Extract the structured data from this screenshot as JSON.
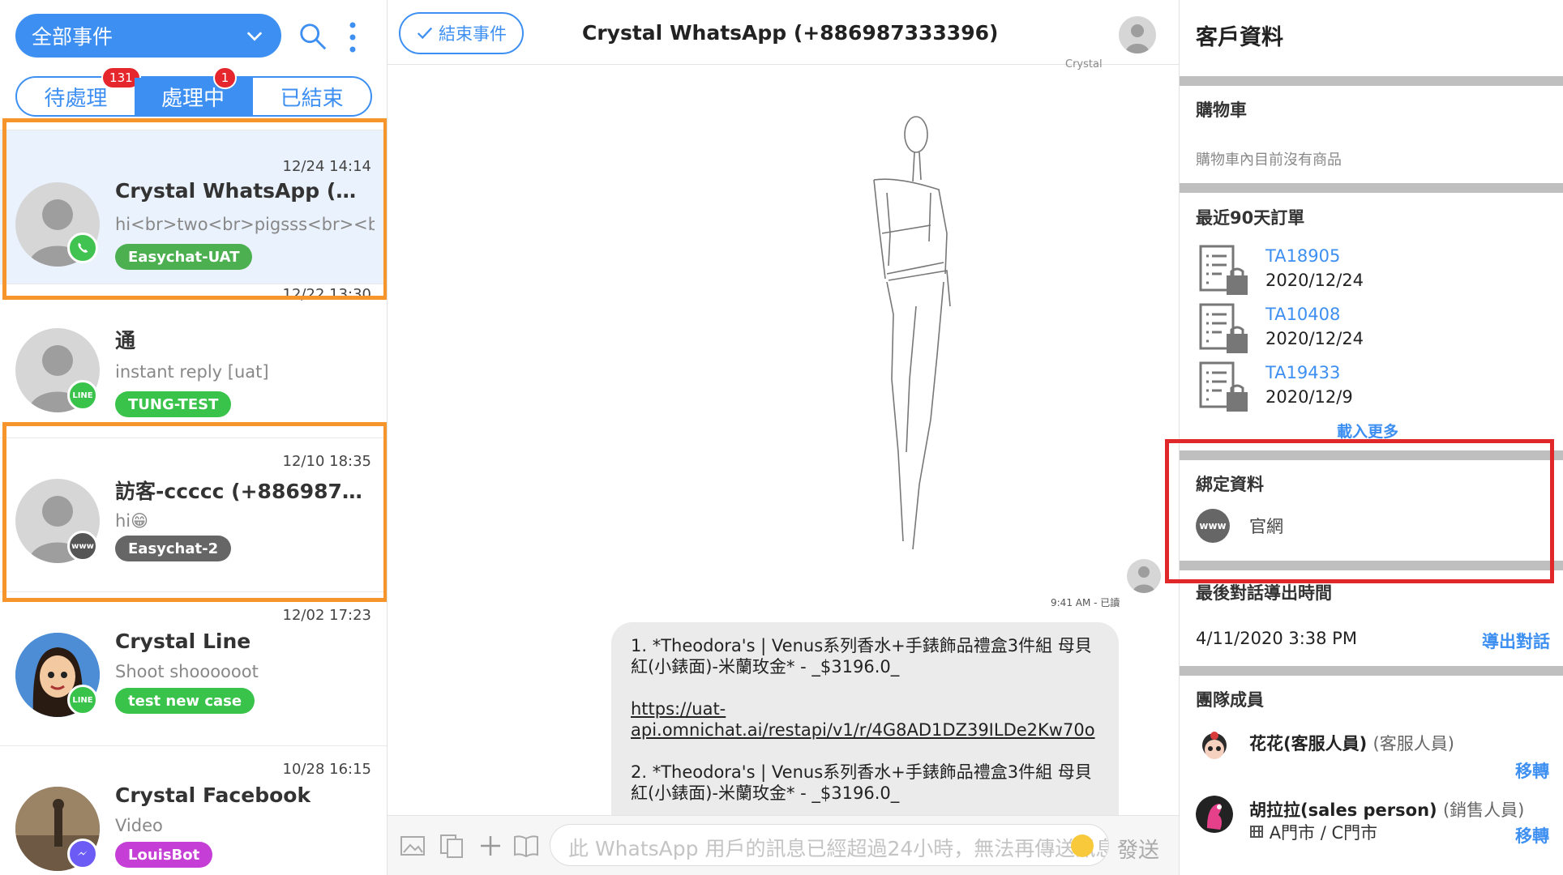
{
  "left": {
    "filter_label": "全部事件",
    "tabs": [
      {
        "label": "待處理",
        "badge": "131"
      },
      {
        "label": "處理中",
        "badge": "1"
      },
      {
        "label": "已結束",
        "badge": ""
      }
    ],
    "conversations": [
      {
        "time": "12/24 14:14",
        "name": "Crystal WhatsApp (+88…",
        "message": "hi<br>two<br>pigsss<br><br>l",
        "tag": "Easychat-UAT",
        "tag_color": "#4caf50",
        "channel": "whatsapp-icon",
        "channel_color": "#40c351"
      },
      {
        "time": "12/22 13:30",
        "name": "通",
        "message": "instant reply [uat]",
        "tag": "TUNG-TEST",
        "tag_color": "#3ac34b",
        "channel": "line-icon",
        "channel_color": "#3ac34b"
      },
      {
        "time": "12/10 18:35",
        "name": "訪客-ccccc (+88698777…",
        "message": "hi😁",
        "tag": "Easychat-2",
        "tag_color": "#666666",
        "channel": "www-icon",
        "channel_color": "#555555"
      },
      {
        "time": "12/02 17:23",
        "name": "Crystal Line",
        "message": "Shoot shoooooot",
        "tag": "test new case",
        "tag_color": "#3ac34b",
        "channel": "line-icon",
        "channel_color": "#3ac34b"
      },
      {
        "time": "10/28 16:15",
        "name": "Crystal Facebook",
        "message": "Video",
        "tag": "LouisBot",
        "tag_color": "#c53fd6",
        "channel": "messenger-icon",
        "channel_color": "#6c5cf5"
      }
    ]
  },
  "chat": {
    "end_button": "結束事件",
    "title": "Crystal WhatsApp (+886987333396)",
    "sender_partial": "Crystal",
    "meta": "9:41 AM - 已讀",
    "bubble": {
      "item1": "1. *Theodora's | Venus系列香水+手錶飾品禮盒3件組 母貝紅(小錶面)-米蘭玫金* - _$3196.0_",
      "link": "https://uat-api.omnichat.ai/restapi/v1/r/4G8AD1DZ39ILDe2Kw70o",
      "item2": "2. *Theodora's | Venus系列香水+手錶飾品禮盒3件組 母貝紅(小錶面)-米蘭玫金* - _$3196.0_"
    },
    "composer_placeholder": "此 WhatsApp 用戶的訊息已經超過24小時，無法再傳送訊息",
    "send_label": "發送"
  },
  "customer": {
    "title": "客戶資料",
    "cart_title": "購物車",
    "cart_empty": "購物車內目前沒有商品",
    "orders_title": "最近90天訂單",
    "orders": [
      {
        "id": "TA18905",
        "date": "2020/12/24"
      },
      {
        "id": "TA10408",
        "date": "2020/12/24"
      },
      {
        "id": "TA19433",
        "date": "2020/12/9"
      }
    ],
    "load_more": "載入更多",
    "binding_title": "綁定資料",
    "binding_icon": "www",
    "binding_label": "官網",
    "export_title": "最後對話導出時間",
    "export_time": "4/11/2020 3:38 PM",
    "export_button": "導出對話",
    "team_title": "團隊成員",
    "members": [
      {
        "name": "花花(客服人員)",
        "role": "(客服人員)",
        "store": "",
        "move": "移轉"
      },
      {
        "name": "胡拉拉(sales person)",
        "role": "(銷售人員)",
        "store": "A門市 / C門市",
        "move": "移轉"
      }
    ]
  },
  "colors": {
    "accent": "#3d8ff2",
    "badge": "#e5262d",
    "highlight_orange": "#f5952c",
    "highlight_red": "#e0282a"
  }
}
